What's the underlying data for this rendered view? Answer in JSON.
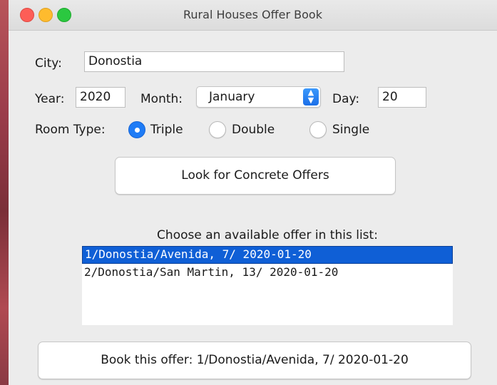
{
  "window": {
    "title": "Rural Houses Offer Book"
  },
  "form": {
    "city_label": "City:",
    "city_value": "Donostia",
    "year_label": "Year:",
    "year_value": "2020",
    "month_label": "Month:",
    "month_value": "January",
    "day_label": "Day:",
    "day_value": "20",
    "room_type_label": "Room Type:",
    "room_types": [
      {
        "label": "Triple",
        "selected": true
      },
      {
        "label": "Double",
        "selected": false
      },
      {
        "label": "Single",
        "selected": false
      }
    ]
  },
  "look_button_label": "Look for Concrete Offers",
  "offers": {
    "title": "Choose an available offer in this list:",
    "items": [
      {
        "text": "1/Donostia/Avenida, 7/ 2020-01-20",
        "selected": true
      },
      {
        "text": "2/Donostia/San Martin, 13/ 2020-01-20",
        "selected": false
      }
    ]
  },
  "book_button_label": "Book this offer: 1/Donostia/Avenida, 7/ 2020-01-20",
  "colors": {
    "selection": "#0f5fd6",
    "accent": "#1f7cf6",
    "titlebar": "#dcdcdc"
  }
}
